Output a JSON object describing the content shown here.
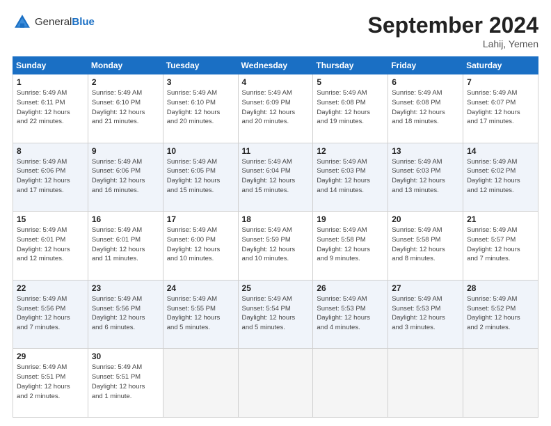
{
  "header": {
    "logo_general": "General",
    "logo_blue": "Blue",
    "month_title": "September 2024",
    "location": "Lahij, Yemen"
  },
  "weekdays": [
    "Sunday",
    "Monday",
    "Tuesday",
    "Wednesday",
    "Thursday",
    "Friday",
    "Saturday"
  ],
  "weeks": [
    [
      {
        "num": "1",
        "info": "Sunrise: 5:49 AM\nSunset: 6:11 PM\nDaylight: 12 hours\nand 22 minutes."
      },
      {
        "num": "2",
        "info": "Sunrise: 5:49 AM\nSunset: 6:10 PM\nDaylight: 12 hours\nand 21 minutes."
      },
      {
        "num": "3",
        "info": "Sunrise: 5:49 AM\nSunset: 6:10 PM\nDaylight: 12 hours\nand 20 minutes."
      },
      {
        "num": "4",
        "info": "Sunrise: 5:49 AM\nSunset: 6:09 PM\nDaylight: 12 hours\nand 20 minutes."
      },
      {
        "num": "5",
        "info": "Sunrise: 5:49 AM\nSunset: 6:08 PM\nDaylight: 12 hours\nand 19 minutes."
      },
      {
        "num": "6",
        "info": "Sunrise: 5:49 AM\nSunset: 6:08 PM\nDaylight: 12 hours\nand 18 minutes."
      },
      {
        "num": "7",
        "info": "Sunrise: 5:49 AM\nSunset: 6:07 PM\nDaylight: 12 hours\nand 17 minutes."
      }
    ],
    [
      {
        "num": "8",
        "info": "Sunrise: 5:49 AM\nSunset: 6:06 PM\nDaylight: 12 hours\nand 17 minutes."
      },
      {
        "num": "9",
        "info": "Sunrise: 5:49 AM\nSunset: 6:06 PM\nDaylight: 12 hours\nand 16 minutes."
      },
      {
        "num": "10",
        "info": "Sunrise: 5:49 AM\nSunset: 6:05 PM\nDaylight: 12 hours\nand 15 minutes."
      },
      {
        "num": "11",
        "info": "Sunrise: 5:49 AM\nSunset: 6:04 PM\nDaylight: 12 hours\nand 15 minutes."
      },
      {
        "num": "12",
        "info": "Sunrise: 5:49 AM\nSunset: 6:03 PM\nDaylight: 12 hours\nand 14 minutes."
      },
      {
        "num": "13",
        "info": "Sunrise: 5:49 AM\nSunset: 6:03 PM\nDaylight: 12 hours\nand 13 minutes."
      },
      {
        "num": "14",
        "info": "Sunrise: 5:49 AM\nSunset: 6:02 PM\nDaylight: 12 hours\nand 12 minutes."
      }
    ],
    [
      {
        "num": "15",
        "info": "Sunrise: 5:49 AM\nSunset: 6:01 PM\nDaylight: 12 hours\nand 12 minutes."
      },
      {
        "num": "16",
        "info": "Sunrise: 5:49 AM\nSunset: 6:01 PM\nDaylight: 12 hours\nand 11 minutes."
      },
      {
        "num": "17",
        "info": "Sunrise: 5:49 AM\nSunset: 6:00 PM\nDaylight: 12 hours\nand 10 minutes."
      },
      {
        "num": "18",
        "info": "Sunrise: 5:49 AM\nSunset: 5:59 PM\nDaylight: 12 hours\nand 10 minutes."
      },
      {
        "num": "19",
        "info": "Sunrise: 5:49 AM\nSunset: 5:58 PM\nDaylight: 12 hours\nand 9 minutes."
      },
      {
        "num": "20",
        "info": "Sunrise: 5:49 AM\nSunset: 5:58 PM\nDaylight: 12 hours\nand 8 minutes."
      },
      {
        "num": "21",
        "info": "Sunrise: 5:49 AM\nSunset: 5:57 PM\nDaylight: 12 hours\nand 7 minutes."
      }
    ],
    [
      {
        "num": "22",
        "info": "Sunrise: 5:49 AM\nSunset: 5:56 PM\nDaylight: 12 hours\nand 7 minutes."
      },
      {
        "num": "23",
        "info": "Sunrise: 5:49 AM\nSunset: 5:56 PM\nDaylight: 12 hours\nand 6 minutes."
      },
      {
        "num": "24",
        "info": "Sunrise: 5:49 AM\nSunset: 5:55 PM\nDaylight: 12 hours\nand 5 minutes."
      },
      {
        "num": "25",
        "info": "Sunrise: 5:49 AM\nSunset: 5:54 PM\nDaylight: 12 hours\nand 5 minutes."
      },
      {
        "num": "26",
        "info": "Sunrise: 5:49 AM\nSunset: 5:53 PM\nDaylight: 12 hours\nand 4 minutes."
      },
      {
        "num": "27",
        "info": "Sunrise: 5:49 AM\nSunset: 5:53 PM\nDaylight: 12 hours\nand 3 minutes."
      },
      {
        "num": "28",
        "info": "Sunrise: 5:49 AM\nSunset: 5:52 PM\nDaylight: 12 hours\nand 2 minutes."
      }
    ],
    [
      {
        "num": "29",
        "info": "Sunrise: 5:49 AM\nSunset: 5:51 PM\nDaylight: 12 hours\nand 2 minutes."
      },
      {
        "num": "30",
        "info": "Sunrise: 5:49 AM\nSunset: 5:51 PM\nDaylight: 12 hours\nand 1 minute."
      },
      {
        "num": "",
        "info": ""
      },
      {
        "num": "",
        "info": ""
      },
      {
        "num": "",
        "info": ""
      },
      {
        "num": "",
        "info": ""
      },
      {
        "num": "",
        "info": ""
      }
    ]
  ]
}
